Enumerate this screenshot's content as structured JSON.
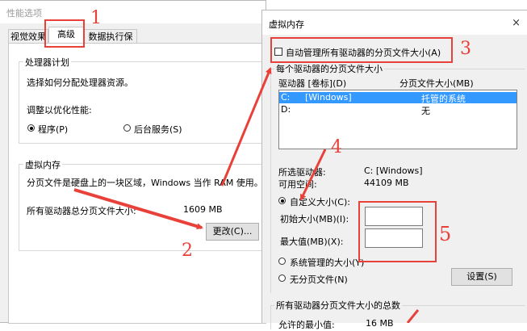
{
  "left_dialog": {
    "title": "性能选项",
    "tabs": [
      "视觉效果",
      "高级",
      "数据执行保护"
    ],
    "processor_group": {
      "legend": "处理器计划",
      "desc": "选择如何分配处理器资源。",
      "optimize_label": "调整以优化性能:",
      "option_programs": "程序(P)",
      "option_services": "后台服务(S)",
      "selected": "programs"
    },
    "vm_group": {
      "legend": "虚拟内存",
      "desc": "分页文件是硬盘上的一块区域，Windows 当作 RAM 使用。",
      "total_label": "所有驱动器总分页文件大小:",
      "total_value": "1609 MB",
      "change_button": "更改(C)..."
    }
  },
  "right_dialog": {
    "title": "虚拟内存",
    "close_glyph": "×",
    "auto_manage_label": "自动管理所有驱动器的分页文件大小(A)",
    "auto_manage_checked": false,
    "per_drive_legend": "每个驱动器的分页文件大小",
    "col_drive": "驱动器 [卷标](D)",
    "col_size": "分页文件大小(MB)",
    "drives": [
      {
        "drive": "C:",
        "label": "[Windows]",
        "size": "托管的系统",
        "selected": true
      },
      {
        "drive": "D:",
        "label": "",
        "size": "无",
        "selected": false
      }
    ],
    "selected_drive_label": "所选驱动器:",
    "selected_drive_value": "C:  [Windows]",
    "free_space_label": "可用空间:",
    "free_space_value": "44109 MB",
    "custom_size_label": "自定义大小(C):",
    "initial_size_label": "初始大小(MB)(I):",
    "max_size_label": "最大值(MB)(X):",
    "system_managed_label": "系统管理的大小(Y)",
    "no_paging_label": "无分页文件(N)",
    "set_button": "设置(S)",
    "size_mode": "custom",
    "total_legend": "所有驱动器分页文件大小的总数",
    "min_allowed_label": "允许的最小值:",
    "min_allowed_value": "16 MB"
  },
  "annotations": {
    "labels": [
      "1",
      "2",
      "3",
      "4",
      "5"
    ],
    "color": "#e8413a"
  }
}
